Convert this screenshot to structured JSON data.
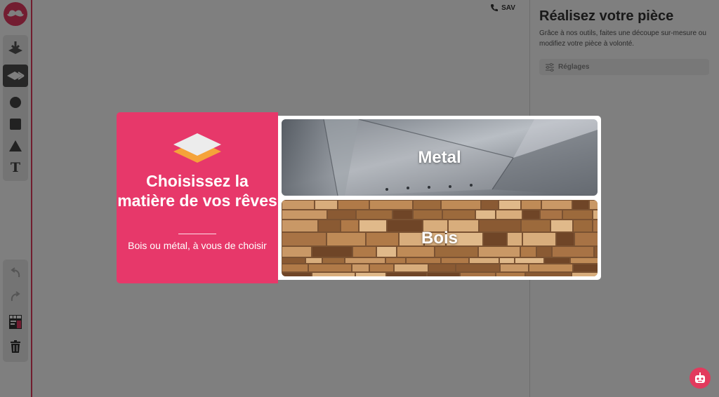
{
  "app": {
    "brand_color": "#e63b62",
    "logo_icon": "mustache-icon"
  },
  "toolbar": {
    "tools": [
      {
        "name": "import-tool",
        "icon": "import-icon"
      },
      {
        "name": "cut-tool",
        "icon": "cut-layer-icon",
        "active": true
      },
      {
        "name": "circle-tool",
        "icon": "circle-icon"
      },
      {
        "name": "square-tool",
        "icon": "square-icon"
      },
      {
        "name": "triangle-tool",
        "icon": "triangle-icon"
      },
      {
        "name": "text-tool",
        "icon": "text-icon",
        "label": "T"
      }
    ],
    "actions": [
      {
        "name": "undo",
        "icon": "undo-icon"
      },
      {
        "name": "redo",
        "icon": "redo-icon"
      },
      {
        "name": "price-list",
        "icon": "price-list-icon"
      },
      {
        "name": "delete",
        "icon": "trash-icon"
      }
    ]
  },
  "header": {
    "sav_label": "SAV",
    "sav_icon": "phone-icon"
  },
  "panel": {
    "title": "Réalisez votre pièce",
    "description": "Grâce à nos outils, faites une découpe sur-mesure ou modifiez votre pièce à volonté.",
    "settings_label": "Réglages",
    "settings_icon": "sliders-icon"
  },
  "modal": {
    "heading": "Choisissez la matière de vos rêves",
    "subtitle": "Bois ou métal, à vous de choisir",
    "icon": "layers-icon",
    "accent_color": "#e7386a",
    "options": [
      {
        "label": "Metal",
        "texture": "brushed-metal"
      },
      {
        "label": "Bois",
        "texture": "wood-parquet"
      }
    ]
  },
  "assistant": {
    "icon": "robot-icon"
  }
}
